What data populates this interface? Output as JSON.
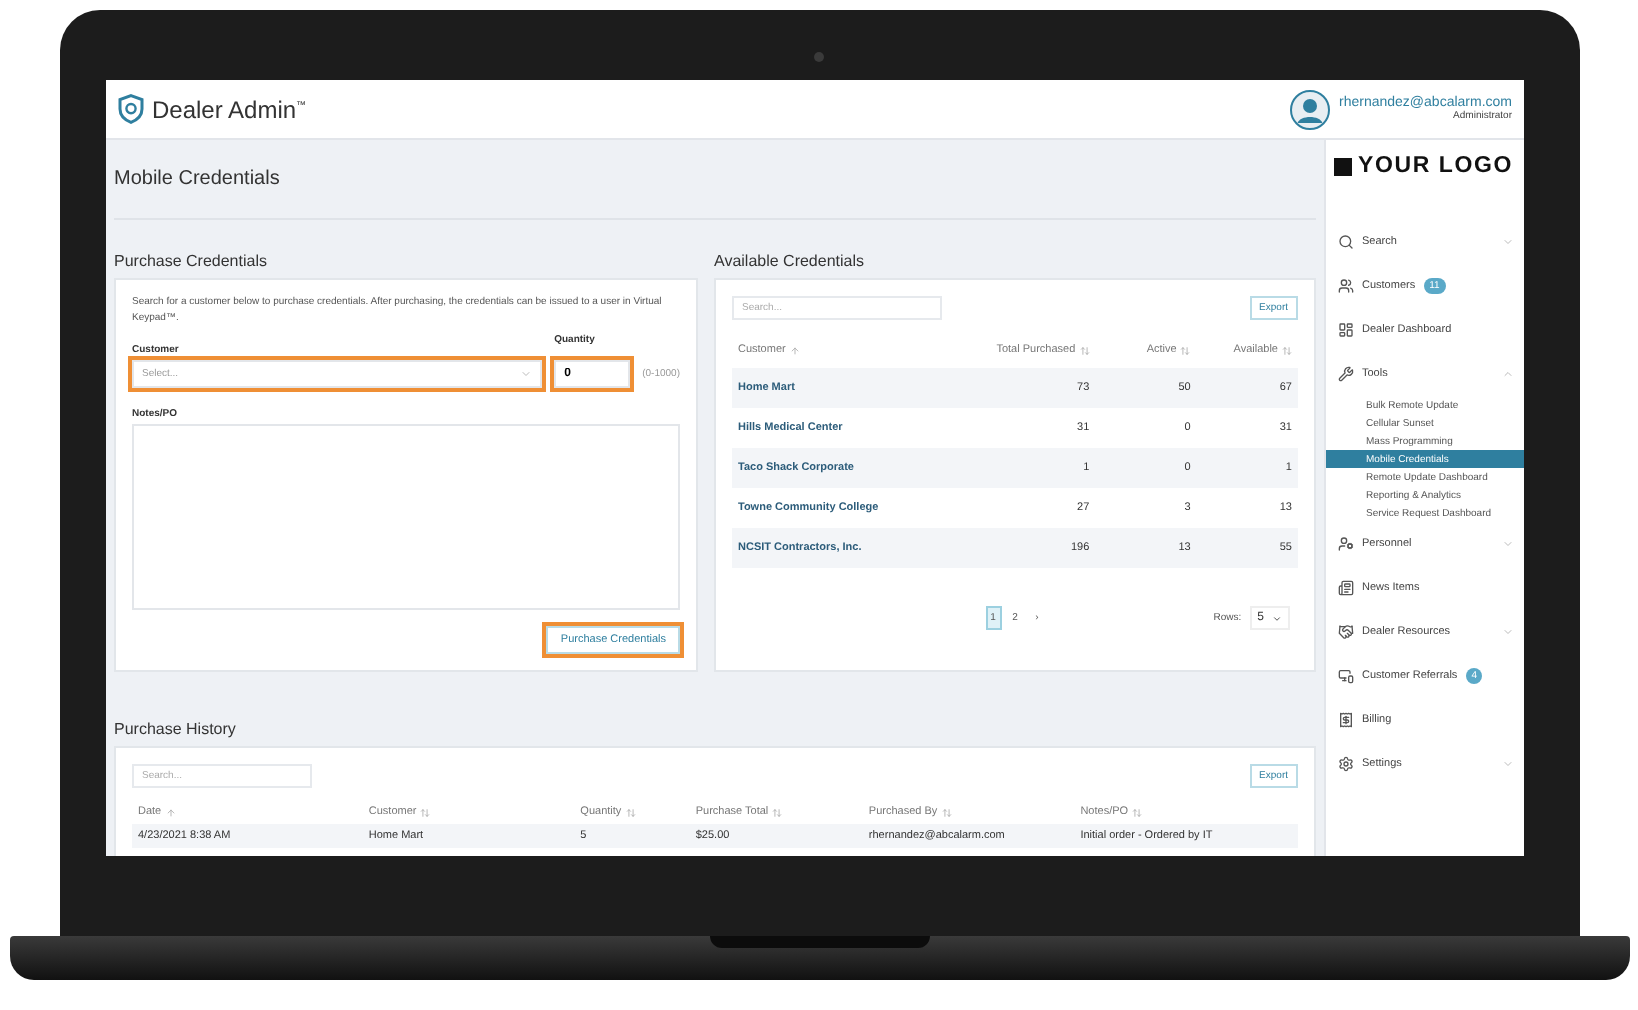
{
  "header": {
    "app_name": "Dealer Admin$^{™}$",
    "user_email": "rhernandez@abcalarm.com",
    "user_role": "Administrator"
  },
  "page_title": "Mobile Credentials",
  "purchase": {
    "title": "Purchase Credentials",
    "intro": "Search for a customer below to purchase credentials. After purchasing, the credentials can be issued to a user in Virtual Keypad™.",
    "customer": {
      "label": "Customer",
      "placeholder": "Select...",
      "highlighted": true
    },
    "quantity": {
      "label": "Quantity",
      "value": "0",
      "range": "(0-1000)",
      "highlighted": true
    },
    "notes": {
      "label": "Notes/PO",
      "highlighted": false
    },
    "button": {
      "label": "Purchase Credentials",
      "highlighted": true
    }
  },
  "available": {
    "title": "Available Credentials",
    "search": {
      "placeholder": "Search..."
    },
    "export": "Export",
    "columns": [
      {
        "label": "Customer",
        "sorted": true
      },
      {
        "label": "Total Purchased",
        "sorted": false
      },
      {
        "label": "Active",
        "sorted": false
      },
      {
        "label": "Available",
        "sorted": false
      }
    ],
    "rows": [
      [
        "Home Mart",
        "73",
        "50",
        "67"
      ],
      [
        "Hills Medical Center",
        "31",
        "0",
        "31"
      ],
      [
        "Taco Shack Corporate",
        "1",
        "0",
        "1"
      ],
      [
        "Towne Community College",
        "27",
        "3",
        "13"
      ],
      [
        "NCSIT Contractors, Inc.",
        "196",
        "13",
        "55"
      ]
    ],
    "pages": [
      {
        "label": "1",
        "selected": true
      },
      {
        "label": "2",
        "selected": false
      }
    ],
    "next": "›",
    "rows_label": "Rows:",
    "rows_value": "5"
  },
  "history": {
    "title": "Purchase History",
    "search": {
      "placeholder": "Search..."
    },
    "export": "Export",
    "columns": [
      {
        "label": "Date",
        "sorted": true
      },
      {
        "label": "Customer",
        "sorted": false
      },
      {
        "label": "Quantity",
        "sorted": false
      },
      {
        "label": "Purchase Total",
        "sorted": false
      },
      {
        "label": "Purchased By",
        "sorted": false
      },
      {
        "label": "Notes/PO",
        "sorted": false
      }
    ],
    "rows": [
      [
        "4/23/2021 8:38 AM",
        "Home Mart",
        "5",
        "$25.00",
        "rhernandez@abcalarm.com",
        "Initial order - Ordered by IT"
      ]
    ]
  },
  "sidebar": {
    "logo": "YOUR LOGO",
    "items": [
      {
        "label": "Search",
        "expandable": true,
        "expanded": false
      },
      {
        "label": "Customers",
        "badge": "11",
        "expandable": false,
        "expanded": false
      },
      {
        "label": "Dealer Dashboard",
        "expandable": false,
        "expanded": false
      },
      {
        "label": "Tools",
        "expandable": true,
        "expanded": true,
        "children": [
          {
            "label": "Bulk Remote Update",
            "selected": false
          },
          {
            "label": "Cellular Sunset",
            "selected": false
          },
          {
            "label": "Mass Programming",
            "selected": false
          },
          {
            "label": "Mobile Credentials",
            "selected": true
          },
          {
            "label": "Remote Update Dashboard",
            "selected": false
          },
          {
            "label": "Reporting & Analytics",
            "selected": false
          },
          {
            "label": "Service Request Dashboard",
            "selected": false
          }
        ]
      },
      {
        "label": "Personnel",
        "expandable": true,
        "expanded": false
      },
      {
        "label": "News Items",
        "expandable": false,
        "expanded": false
      },
      {
        "label": "Dealer Resources",
        "expandable": true,
        "expanded": false
      },
      {
        "label": "Customer Referrals",
        "badge": "4",
        "expandable": false,
        "expanded": false
      },
      {
        "label": "Billing",
        "expandable": false,
        "expanded": false
      },
      {
        "label": "Settings",
        "expandable": true,
        "expanded": false
      }
    ]
  }
}
